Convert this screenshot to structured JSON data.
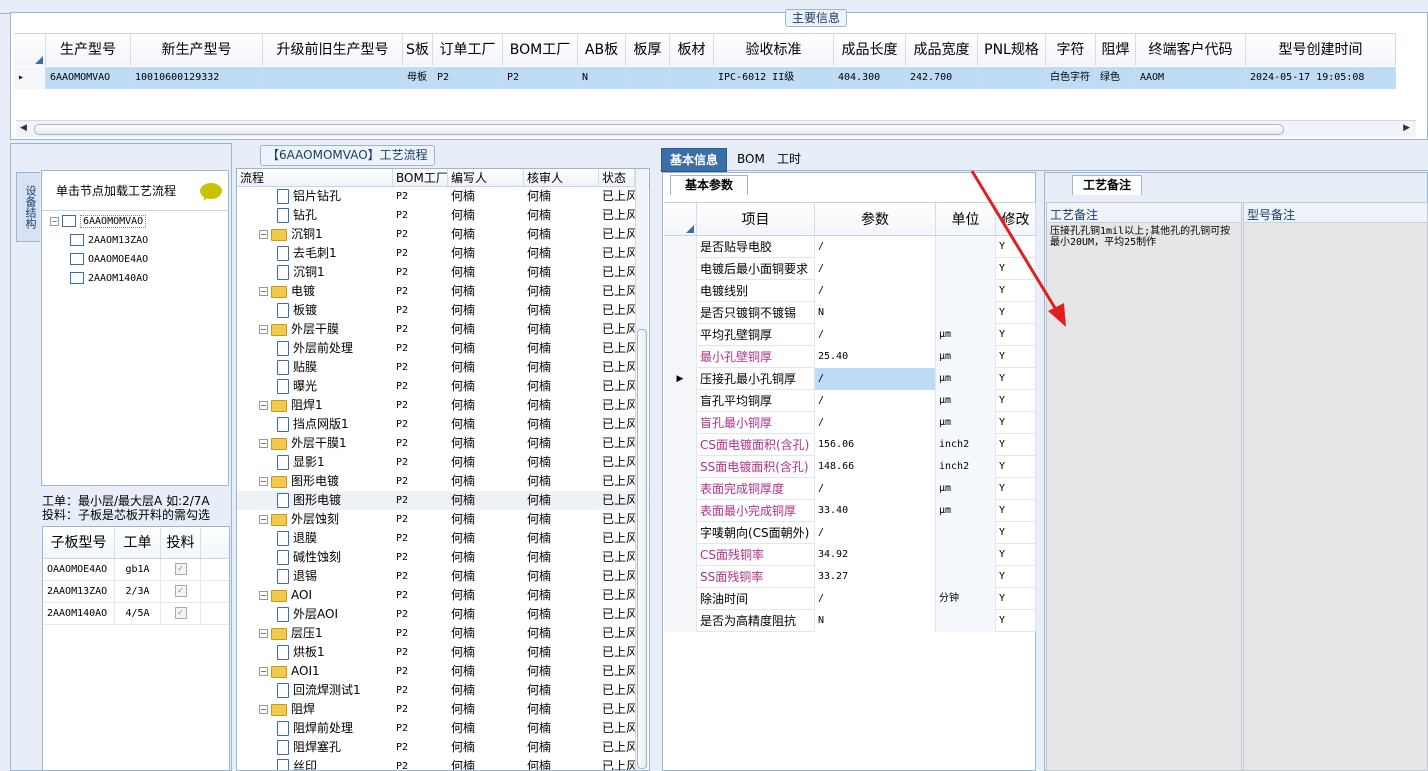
{
  "main_info": {
    "legend": "主要信息",
    "columns": [
      "生产型号",
      "新生产型号",
      "升级前旧生产型号",
      "S板",
      "订单工厂",
      "BOM工厂",
      "AB板",
      "板厚",
      "板材",
      "验收标准",
      "成品长度",
      "成品宽度",
      "PNL规格",
      "字符",
      "阻焊",
      "终端客户代码",
      "型号创建时间"
    ],
    "row": [
      "6AAOMOMVAO",
      "10010600129332",
      "",
      "母板",
      "P2",
      "P2",
      "N",
      "",
      "",
      "IPC-6012 II级",
      "404.300",
      "242.700",
      "",
      "白色字符",
      "绿色",
      "AAOM",
      "2024-05-17 19:05:08"
    ]
  },
  "left_panel": {
    "vertical_tab": "设备结构",
    "hint": "单击节点加载工艺流程",
    "tree": {
      "root": "6AAOMOMVAO",
      "children": [
        "2AAOM13ZAO",
        "OAAOMOE4AO",
        "2AAOM140AO"
      ]
    },
    "note1": "工单：最小层/最大层A 如:2/7A",
    "note2": "投料：子板是芯板开料的需勾选",
    "subgrid": {
      "headers": [
        "子板型号",
        "工单",
        "投料"
      ],
      "rows": [
        [
          "OAAOMOE4AO",
          "gb1A"
        ],
        [
          "2AAOM13ZAO",
          "2/3A"
        ],
        [
          "2AAOM140AO",
          "4/5A"
        ]
      ]
    }
  },
  "flow": {
    "legend": "【6AAOMOMVAO】工艺流程",
    "headers": [
      "流程",
      "BOM工厂",
      "编写人",
      "核审人",
      "状态"
    ],
    "factory": "P2",
    "author": "何楠",
    "reviewer": "何楠",
    "status": "已上风",
    "rows": [
      {
        "name": "铝片钻孔",
        "type": "leaf"
      },
      {
        "name": "钻孔",
        "type": "leaf"
      },
      {
        "name": "沉铜1",
        "type": "folder"
      },
      {
        "name": "去毛刺1",
        "type": "leaf"
      },
      {
        "name": "沉铜1",
        "type": "leaf"
      },
      {
        "name": "电镀",
        "type": "folder"
      },
      {
        "name": "板镀",
        "type": "leaf"
      },
      {
        "name": "外层干膜",
        "type": "folder"
      },
      {
        "name": "外层前处理",
        "type": "leaf"
      },
      {
        "name": "贴膜",
        "type": "leaf"
      },
      {
        "name": "曝光",
        "type": "leaf"
      },
      {
        "name": "阻焊1",
        "type": "folder"
      },
      {
        "name": "挡点网版1",
        "type": "leaf"
      },
      {
        "name": "外层干膜1",
        "type": "folder"
      },
      {
        "name": "显影1",
        "type": "leaf"
      },
      {
        "name": "图形电镀",
        "type": "folder"
      },
      {
        "name": "图形电镀",
        "type": "leaf"
      },
      {
        "name": "外层蚀刻",
        "type": "folder"
      },
      {
        "name": "退膜",
        "type": "leaf"
      },
      {
        "name": "碱性蚀刻",
        "type": "leaf"
      },
      {
        "name": "退锡",
        "type": "leaf"
      },
      {
        "name": "AOI",
        "type": "folder"
      },
      {
        "name": "外层AOI",
        "type": "leaf"
      },
      {
        "name": "层压1",
        "type": "folder"
      },
      {
        "name": "烘板1",
        "type": "leaf"
      },
      {
        "name": "AOI1",
        "type": "folder"
      },
      {
        "name": "回流焊测试1",
        "type": "leaf"
      },
      {
        "name": "阻焊",
        "type": "folder"
      },
      {
        "name": "阻焊前处理",
        "type": "leaf"
      },
      {
        "name": "阻焊塞孔",
        "type": "leaf"
      },
      {
        "name": "丝印",
        "type": "leaf"
      }
    ]
  },
  "tabs": [
    "基本信息",
    "BOM",
    "工时"
  ],
  "basic": {
    "section": "基本参数",
    "headers": [
      "项目",
      "参数",
      "单位",
      "修改"
    ],
    "rows": [
      {
        "item": "是否贴导电胶",
        "value": "/",
        "unit": "",
        "mod": "Y",
        "pink": false
      },
      {
        "item": "电镀后最小面铜要求",
        "value": "/",
        "unit": "",
        "mod": "Y",
        "pink": false
      },
      {
        "item": "电镀线别",
        "value": "/",
        "unit": "",
        "mod": "Y",
        "pink": false
      },
      {
        "item": "是否只镀铜不镀锡",
        "value": "N",
        "unit": "",
        "mod": "Y",
        "pink": false
      },
      {
        "item": "平均孔壁铜厚",
        "value": "/",
        "unit": "μm",
        "mod": "Y",
        "pink": false
      },
      {
        "item": "最小孔壁铜厚",
        "value": "25.40",
        "unit": "μm",
        "mod": "Y",
        "pink": true
      },
      {
        "item": "压接孔最小孔铜厚",
        "value": "/",
        "unit": "μm",
        "mod": "Y",
        "pink": false
      },
      {
        "item": "盲孔平均铜厚",
        "value": "/",
        "unit": "μm",
        "mod": "Y",
        "pink": false
      },
      {
        "item": "盲孔最小铜厚",
        "value": "/",
        "unit": "μm",
        "mod": "Y",
        "pink": true
      },
      {
        "item": "CS面电镀面积(含孔)",
        "value": "156.06",
        "unit": "inch2",
        "mod": "Y",
        "pink": true
      },
      {
        "item": "SS面电镀面积(含孔)",
        "value": "148.66",
        "unit": "inch2",
        "mod": "Y",
        "pink": true
      },
      {
        "item": "表面完成铜厚度",
        "value": "/",
        "unit": "μm",
        "mod": "Y",
        "pink": true
      },
      {
        "item": "表面最小完成铜厚",
        "value": "33.40",
        "unit": "μm",
        "mod": "Y",
        "pink": true
      },
      {
        "item": "字唛朝向(CS面朝外)",
        "value": "/",
        "unit": "",
        "mod": "Y",
        "pink": false
      },
      {
        "item": "CS面残铜率",
        "value": "34.92",
        "unit": "",
        "mod": "Y",
        "pink": true
      },
      {
        "item": "SS面残铜率",
        "value": "33.27",
        "unit": "",
        "mod": "Y",
        "pink": true
      },
      {
        "item": "除油时间",
        "value": "/",
        "unit": "分钟",
        "mod": "Y",
        "pink": false
      },
      {
        "item": "是否为高精度阻抗",
        "value": "N",
        "unit": "",
        "mod": "Y",
        "pink": false
      }
    ]
  },
  "remarks": {
    "tab": "工艺备注",
    "process_label": "工艺备注",
    "process_text": "压接孔孔铜1mil以上;其他孔的孔铜可按最小20UM，平均25制作",
    "model_label": "型号备注"
  },
  "colors": {
    "accent": "#3a6ea8",
    "selection": "#bfdcf7",
    "pink": "#b0308a",
    "arrow": "#e02020"
  }
}
